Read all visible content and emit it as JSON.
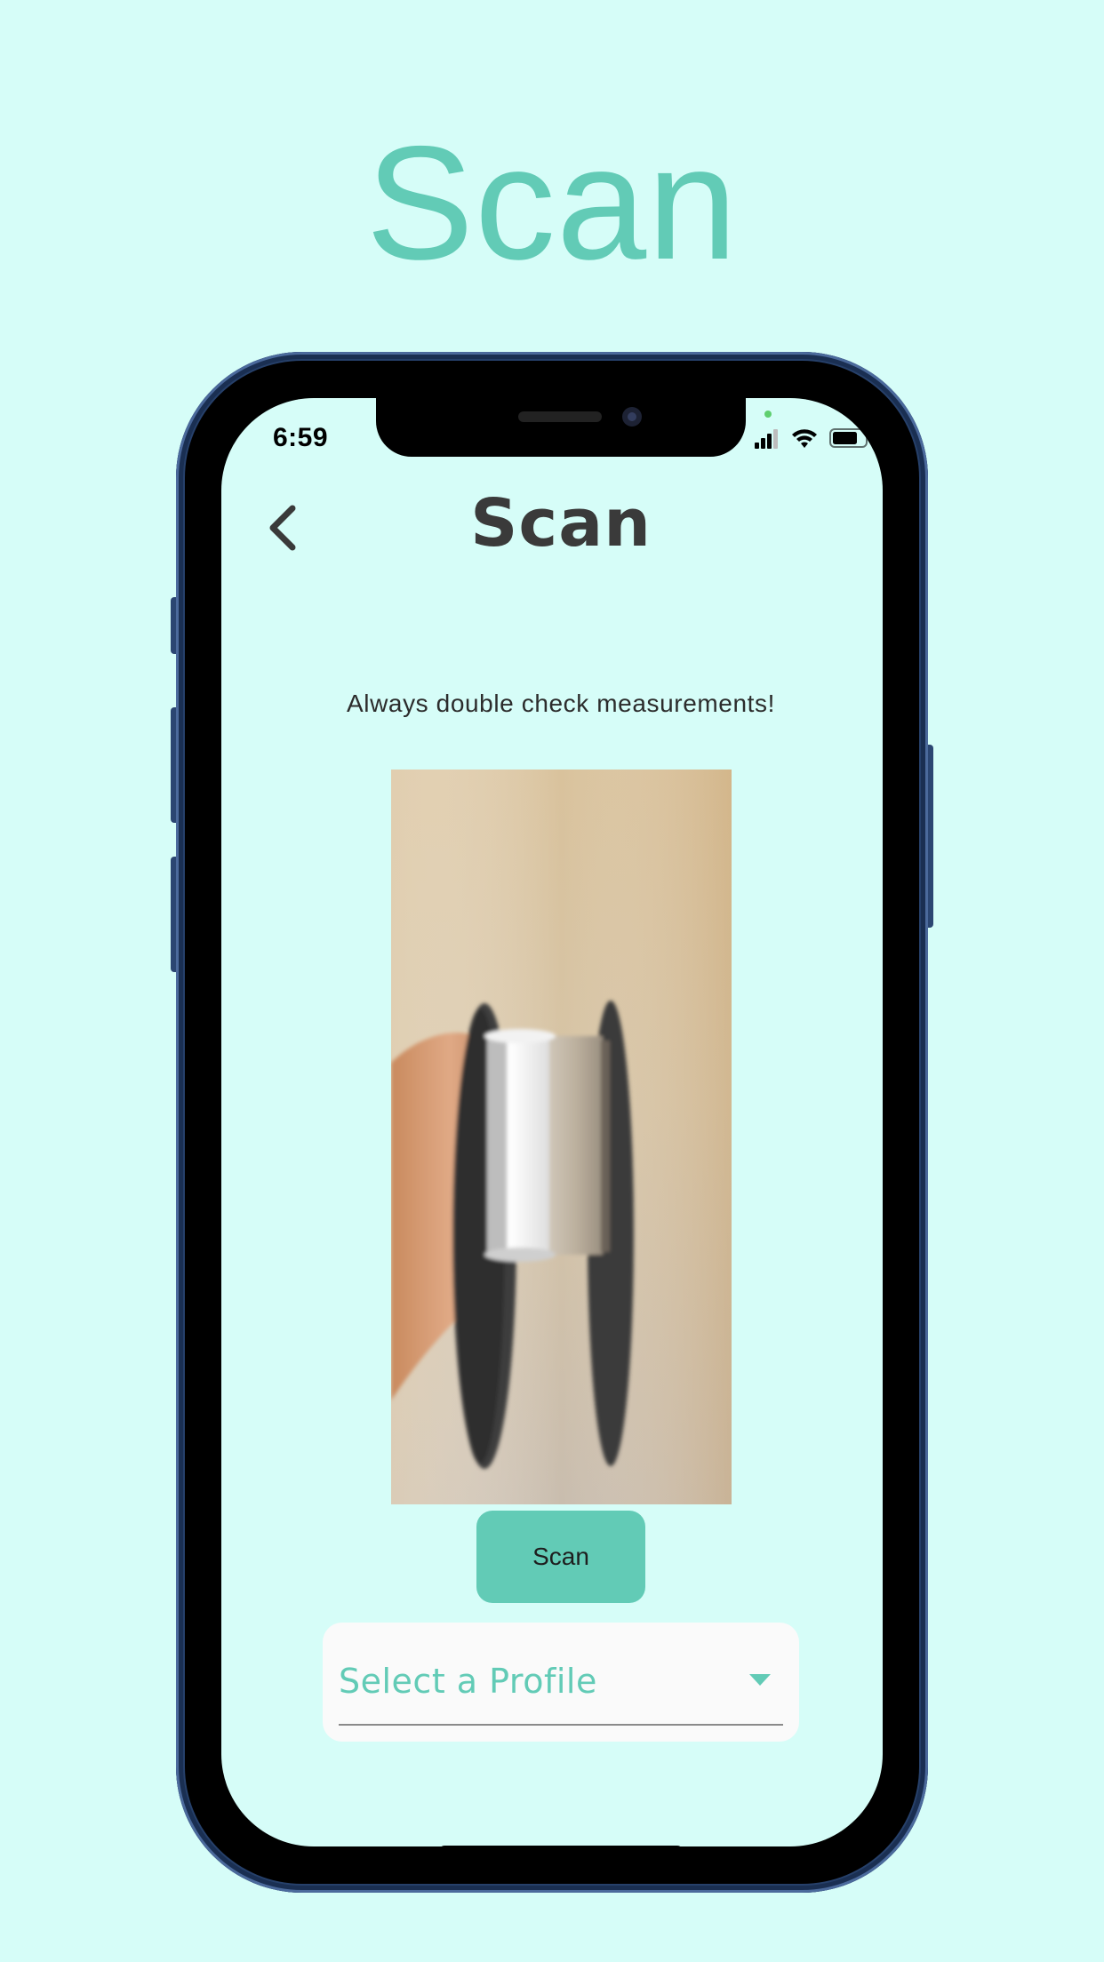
{
  "marketing": {
    "title": "Scan"
  },
  "status_bar": {
    "time": "6:59"
  },
  "header": {
    "title": "Scan",
    "back_icon": "chevron-left-icon"
  },
  "main": {
    "hint": "Always double check measurements!",
    "photo_subject": "filament-spool-photo",
    "scan_label": "Scan",
    "profile_select": {
      "placeholder": "Select a Profile"
    }
  },
  "colors": {
    "background": "#d6fdf8",
    "accent": "#62cbb6",
    "title_text": "#3a3a3a",
    "phone_frame": "#26406a"
  }
}
